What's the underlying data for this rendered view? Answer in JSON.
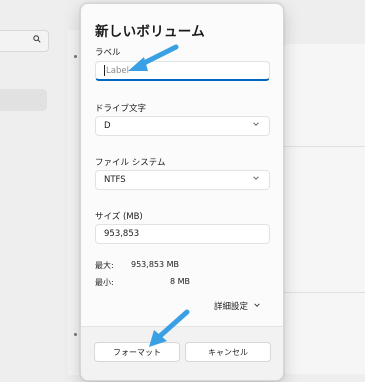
{
  "dialog": {
    "title": "新しいボリューム",
    "label_field": {
      "label": "ラベル",
      "placeholder": "Label"
    },
    "drive_letter": {
      "label": "ドライブ文字",
      "value": "D"
    },
    "file_system": {
      "label": "ファイル システム",
      "value": "NTFS"
    },
    "size": {
      "label": "サイズ (MB)",
      "value": "953,853"
    },
    "max": {
      "label": "最大:",
      "value": "953,853 MB"
    },
    "min": {
      "label": "最小:",
      "value": "8 MB"
    },
    "advanced_label": "詳細設定",
    "format_button": "フォーマット",
    "cancel_button": "キャンセル"
  },
  "background": {
    "search_icon": "search-icon"
  },
  "annotation_color": "#3aa0e6",
  "accent_color": "#0067c0"
}
